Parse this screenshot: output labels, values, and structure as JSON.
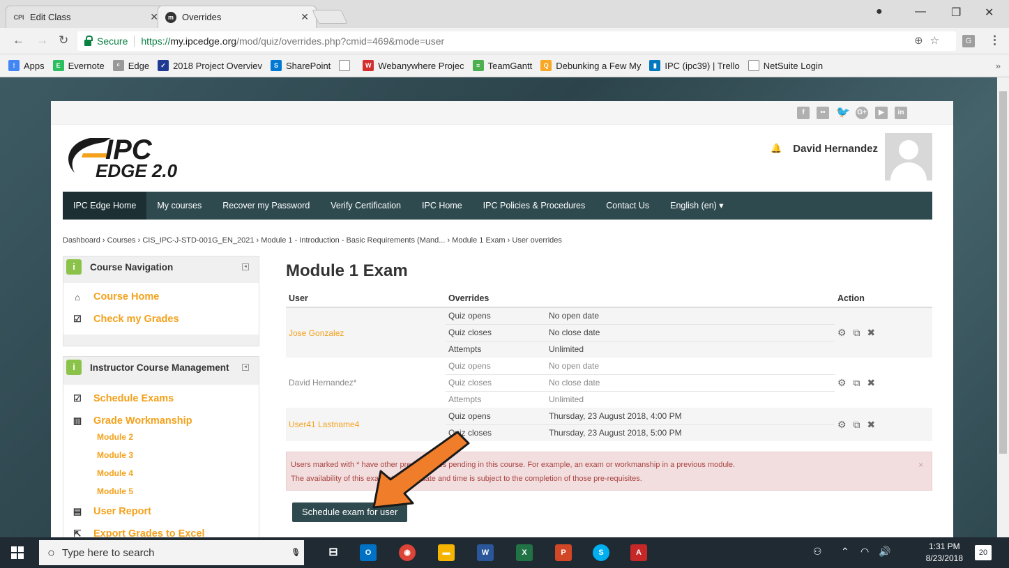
{
  "browser": {
    "tabs": [
      {
        "title": "Edit Class",
        "favicon": "CPI"
      },
      {
        "title": "Overrides",
        "favicon": "m"
      }
    ],
    "address": {
      "secure_label": "Secure",
      "url_scheme": "https://",
      "url_domain": "my.ipcedge.org",
      "url_path": "/mod/quiz/overrides.php?cmid=469&mode=user"
    },
    "bookmarks": [
      {
        "label": "Apps",
        "color": "#4285f4"
      },
      {
        "label": "Evernote",
        "color": "#2dbe60"
      },
      {
        "label": "Edge",
        "color": "#999999"
      },
      {
        "label": "2018 Project Overviev",
        "color": "#1f3a93"
      },
      {
        "label": "SharePoint",
        "color": "#0078d4"
      },
      {
        "label": "",
        "color": "#ffffff"
      },
      {
        "label": "Webanywhere Projec",
        "color": "#d32f2f"
      },
      {
        "label": "TeamGantt",
        "color": "#4caf50"
      },
      {
        "label": "Debunking a Few My",
        "color": "#f9a825"
      },
      {
        "label": "IPC (ipc39) | Trello",
        "color": "#0079bf"
      },
      {
        "label": "NetSuite Login",
        "color": "#ffffff"
      }
    ],
    "bookmarks_overflow": "»"
  },
  "site": {
    "logo_text_top": "IPC",
    "logo_text_bottom": "EDGE 2.0",
    "user_name": "David Hernandez",
    "nav": [
      "IPC Edge Home",
      "My courses",
      "Recover my Password",
      "Verify Certification",
      "IPC Home",
      "IPC Policies & Procedures",
      "Contact Us",
      "English (en) ▾"
    ],
    "breadcrumb": "Dashboard › Courses › CIS_IPC-J-STD-001G_EN_2021 › Module 1 - Introduction - Basic Requirements (Mand... › Module 1 Exam › User overrides"
  },
  "course_nav": {
    "title": "Course Navigation",
    "links": [
      "Course Home",
      "Check my Grades"
    ]
  },
  "instructor": {
    "title": "Instructor Course Management",
    "links": [
      "Schedule Exams",
      "Grade Workmanship"
    ],
    "modules": [
      "Module 2",
      "Module 3",
      "Module 4",
      "Module 5"
    ],
    "user_report": "User Report",
    "export": "Export Grades to Excel"
  },
  "main": {
    "title": "Module 1 Exam",
    "headers": {
      "user": "User",
      "overrides": "Overrides",
      "action": "Action"
    },
    "rows": [
      {
        "user": "Jose Gonzalez",
        "lines": [
          {
            "label": "Quiz opens",
            "value": "No open date"
          },
          {
            "label": "Quiz closes",
            "value": "No close date"
          },
          {
            "label": "Attempts",
            "value": "Unlimited"
          }
        ]
      },
      {
        "user": "David Hernandez*",
        "lines": [
          {
            "label": "Quiz opens",
            "value": "No open date"
          },
          {
            "label": "Quiz closes",
            "value": "No close date"
          },
          {
            "label": "Attempts",
            "value": "Unlimited"
          }
        ]
      },
      {
        "user": "User41 Lastname4",
        "lines": [
          {
            "label": "Quiz opens",
            "value": "Thursday, 23 August 2018, 4:00 PM"
          },
          {
            "label": "Quiz closes",
            "value": "Thursday, 23 August 2018, 5:00 PM"
          }
        ]
      }
    ],
    "alert_line1": "Users marked with * have other pre-requisites pending in this course. For example, an exam or workmanship in a previous module.",
    "alert_line2": "The availability of this exam at the set date and time is subject to the completion of those pre-requisites.",
    "schedule_button": "Schedule exam for user"
  },
  "taskbar": {
    "search_placeholder": "Type here to search",
    "time": "1:31 PM",
    "date": "8/23/2018",
    "notifications": "20"
  }
}
